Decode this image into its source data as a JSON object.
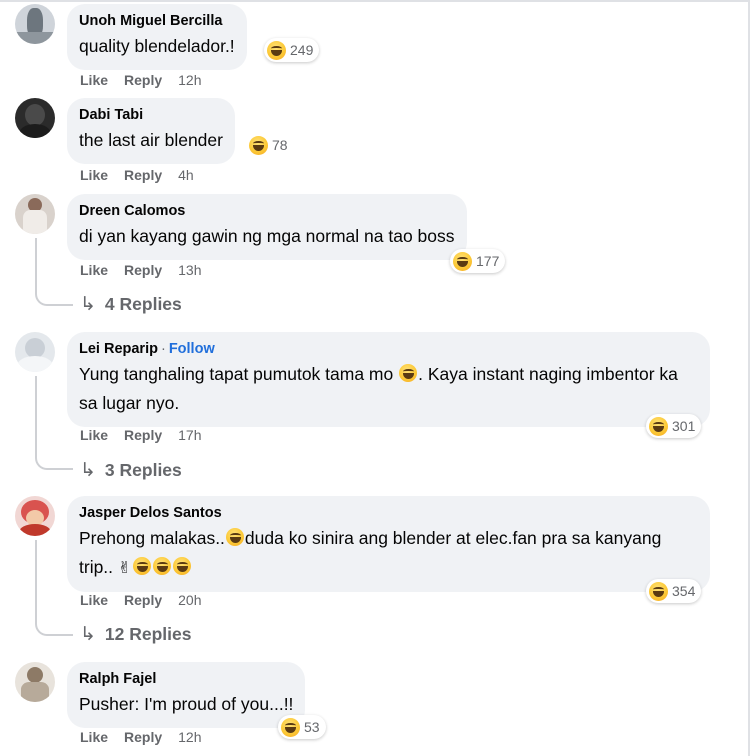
{
  "comments": [
    {
      "name": "Unoh Miguel Bercilla",
      "text": "quality blendelador.!",
      "reactions": "249",
      "like": "Like",
      "reply": "Reply",
      "time": "12h",
      "avatar_color": "#9aa3ab"
    },
    {
      "name": "Dabi Tabi",
      "text": "the last air blender",
      "reactions": "78",
      "like": "Like",
      "reply": "Reply",
      "time": "4h",
      "avatar_color": "#3a3a3a"
    },
    {
      "name": "Dreen Calomos",
      "text": "di yan kayang gawin ng mga normal na tao boss",
      "reactions": "177",
      "like": "Like",
      "reply": "Reply",
      "time": "13h",
      "replies": "4 Replies",
      "avatar_color": "#b9a49a"
    },
    {
      "name": "Lei Reparip",
      "follow": "Follow",
      "text_part1": "Yung tanghaling tapat pumutok tama mo",
      "text_part2": ". Kaya instant naging imbentor ka sa lugar nyo.",
      "reactions": "301",
      "like": "Like",
      "reply": "Reply",
      "time": "17h",
      "replies": "3 Replies",
      "avatar_color": "#d8dde3"
    },
    {
      "name": "Jasper Delos Santos",
      "text_part1": "Prehong malakas..",
      "text_part2": "duda ko sinira ang blender at elec.fan pra sa kanyang trip..",
      "reactions": "354",
      "like": "Like",
      "reply": "Reply",
      "time": "20h",
      "replies": "12 Replies",
      "avatar_color": "#d9534f"
    },
    {
      "name": "Ralph Fajel",
      "text": "Pusher: I'm proud of you...!!",
      "reactions": "53",
      "like": "Like",
      "reply": "Reply",
      "time": "12h",
      "avatar_color": "#c8bfb4"
    }
  ],
  "icons": {
    "reaction": "haha-emoji-icon",
    "reply_arrow": "reply-arrow-icon",
    "peace": "victory-hand-icon"
  },
  "colors": {
    "bubble": "#f0f2f5",
    "meta": "#65676b",
    "follow": "#216fdb"
  }
}
